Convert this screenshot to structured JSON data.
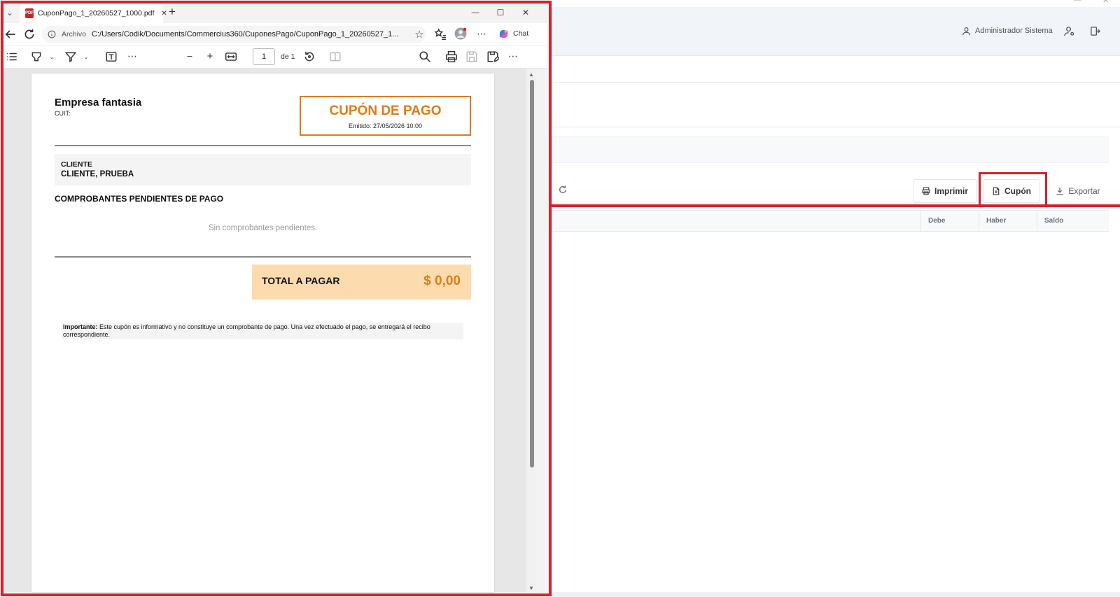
{
  "browser": {
    "tab_title": "CuponPago_1_20260527_1000.pdf",
    "tab_close": "✕",
    "new_tab": "+",
    "window_controls": {
      "minimize": "—",
      "maximize": "☐",
      "close": "✕"
    },
    "address": {
      "scheme_label": "Archivo",
      "url": "C:/Users/Codik/Documents/Commercius360/CuponesPago/CuponPago_1_20260527_1..."
    },
    "chat_label": "Chat"
  },
  "pdf_toolbar": {
    "page_input": "1",
    "page_total": "de 1"
  },
  "document": {
    "company_name": "Empresa fantasia",
    "cuit_label": "CUIT:",
    "coupon_title": "CUPÓN DE PAGO",
    "emitted": "Emitido: 27/05/2026 10:00",
    "client_label": "CLIENTE",
    "client_name": "CLIENTE, PRUEBA",
    "pending_title": "COMPROBANTES PENDIENTES DE PAGO",
    "pending_empty": "Sin comprobantes pendientes.",
    "total_label": "TOTAL A PAGAR",
    "total_value": "$ 0,00",
    "note_bold": "Importante:",
    "note_text": " Este cupón es informativo y no constituye un comprobante de pago. Una vez efectuado el pago, se entregará el recibo correspondiente."
  },
  "app": {
    "user_name": "Administrador Sistema",
    "buttons": {
      "print": "Imprimir",
      "coupon": "Cupón",
      "export": "Exportar"
    },
    "grid_columns": [
      "Debe",
      "Haber",
      "Saldo"
    ]
  },
  "colors": {
    "highlight": "#d7212c",
    "coupon_accent": "#e07b18",
    "total_bg": "#fcdcae"
  }
}
